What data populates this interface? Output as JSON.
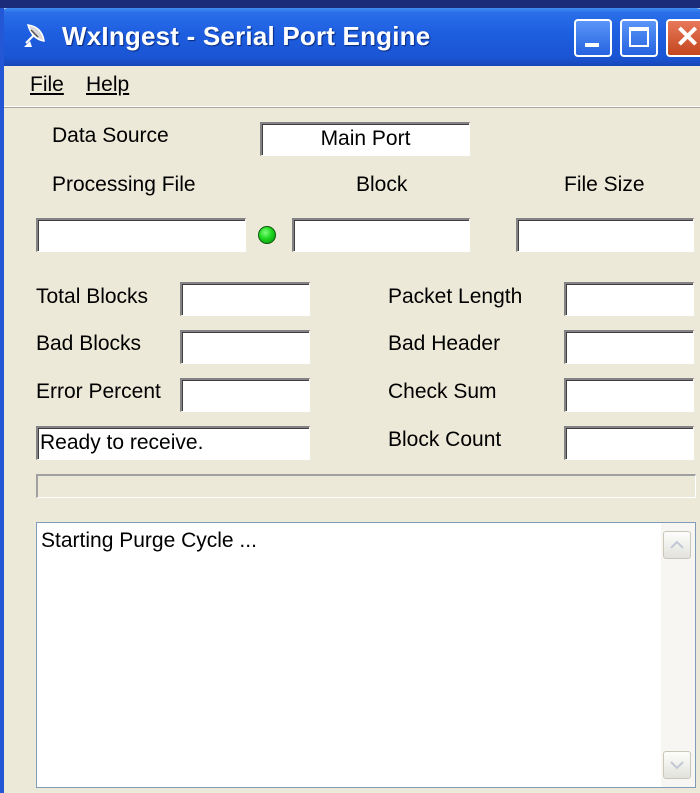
{
  "window": {
    "title": "WxIngest - Serial Port Engine"
  },
  "menu": {
    "file": "File",
    "help": "Help"
  },
  "labels": {
    "data_source": "Data Source",
    "processing_file": "Processing File",
    "block": "Block",
    "file_size": "File Size",
    "total_blocks": "Total Blocks",
    "bad_blocks": "Bad Blocks",
    "error_percent": "Error Percent",
    "packet_length": "Packet Length",
    "bad_header": "Bad Header",
    "check_sum": "Check Sum",
    "block_count": "Block Count"
  },
  "values": {
    "data_source": "Main Port",
    "processing_file": "",
    "block": "",
    "file_size": "",
    "total_blocks": "",
    "bad_blocks": "",
    "error_percent": "",
    "packet_length": "",
    "bad_header": "",
    "check_sum": "",
    "block_count": "",
    "status": "Ready to receive."
  },
  "progress": 0,
  "log": {
    "text": "Starting Purge Cycle ..."
  },
  "indicator": {
    "color": "#1ed61e"
  },
  "icons": {
    "app": "satellite-dish-icon",
    "minimize": "minimize-icon",
    "maximize": "maximize-icon",
    "close": "close-icon",
    "scroll_up": "chevron-up-icon",
    "scroll_down": "chevron-down-icon"
  }
}
